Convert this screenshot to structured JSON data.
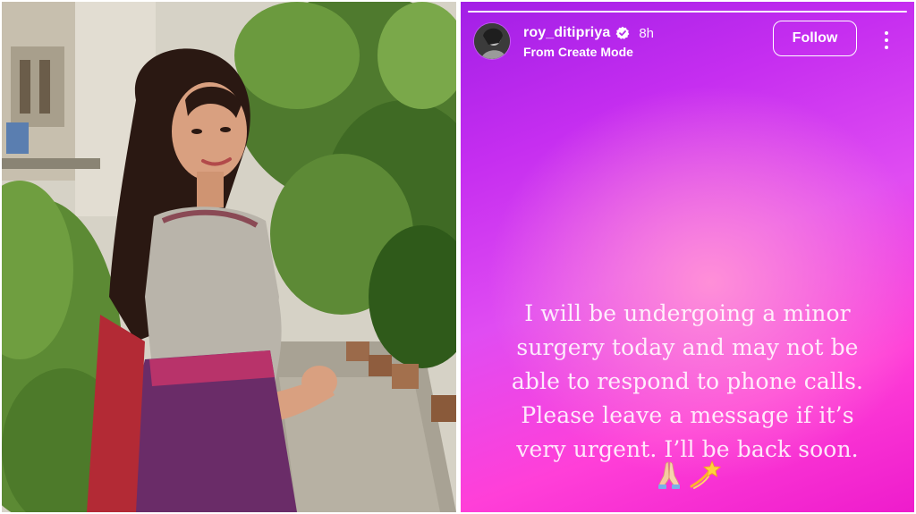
{
  "photo": {
    "alt": "Woman in saree"
  },
  "story": {
    "username": "roy_ditipriya",
    "verified_icon": "verified-badge-icon",
    "time_ago": "8h",
    "subtitle": "From Create Mode",
    "follow_label": "Follow",
    "more_icon": "more-options-icon",
    "text_lines": [
      "I will be undergoing a minor",
      "surgery today and may not be",
      "able to respond to phone calls.",
      "Please leave a message if it’s",
      "very urgent. I’ll be back soon."
    ],
    "emojis": [
      "folded-hands-icon",
      "dizzy-star-icon"
    ]
  },
  "colors": {
    "gradient_top": "#a21fe6",
    "gradient_bottom": "#ee1ccc",
    "text": "#ffffff"
  }
}
